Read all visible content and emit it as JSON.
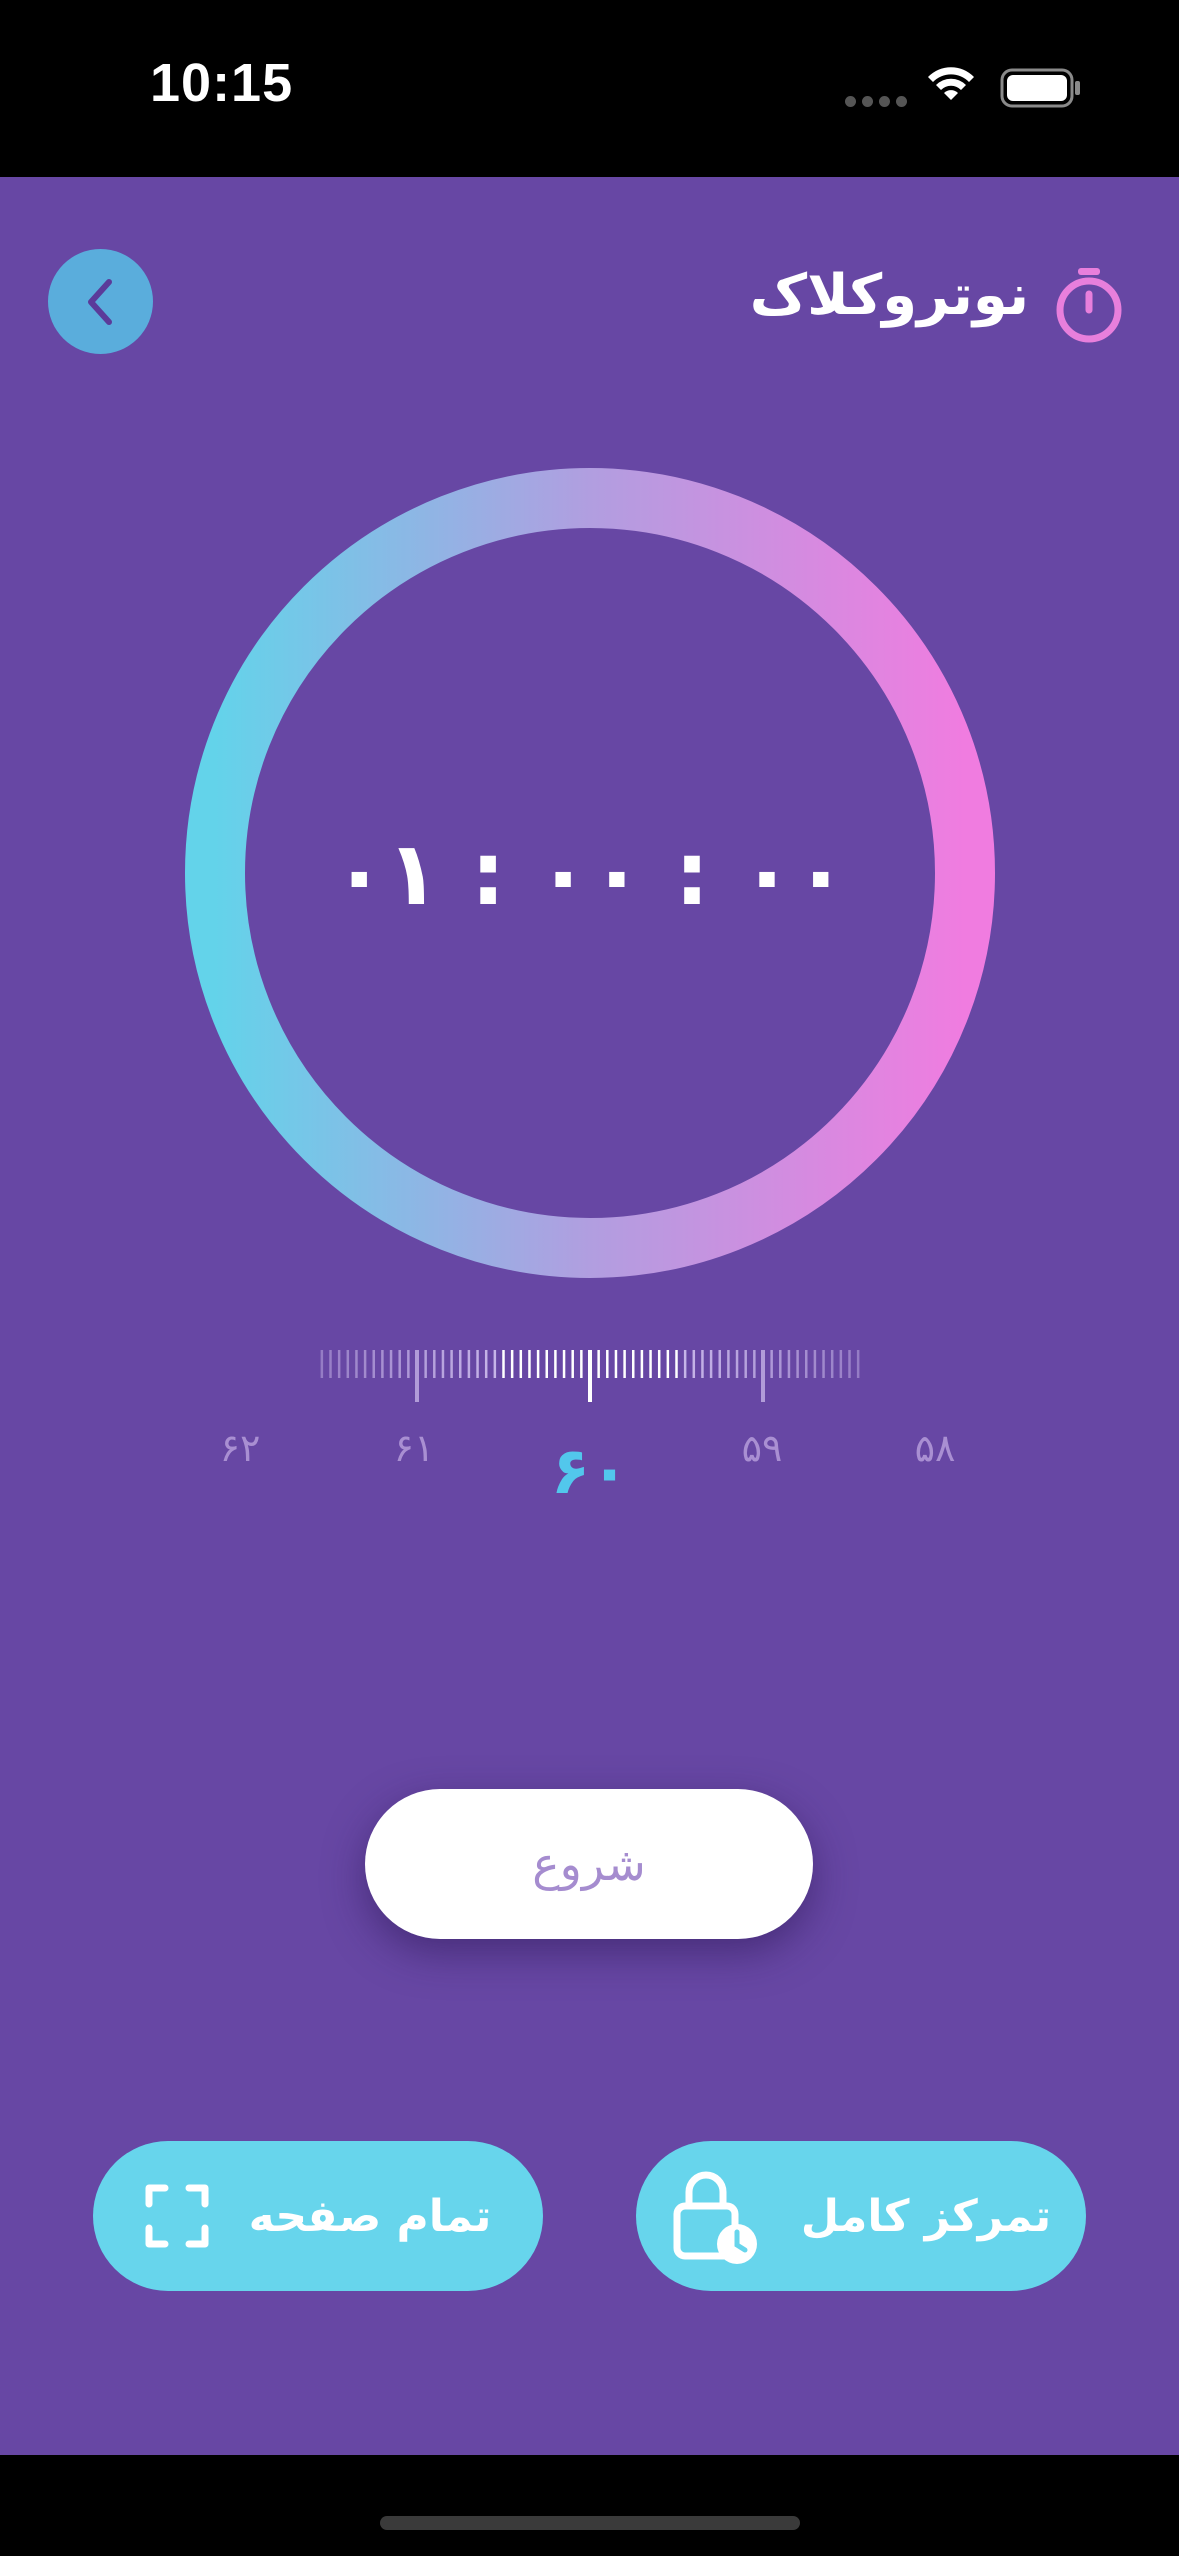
{
  "status_bar": {
    "time": "10:15"
  },
  "header": {
    "title": "نوتروکلاک",
    "back_icon": "chevron-left-icon",
    "timer_icon": "stopwatch-icon"
  },
  "timer": {
    "display": "۰۱ : ۰۰ : ۰۰",
    "gradient_colors": [
      "#63d3ea",
      "#b19ee0",
      "#f07ce0"
    ]
  },
  "ruler": {
    "selected_value": "۶۰",
    "labels": [
      "۶۲",
      "۶۱",
      "۵۹",
      "۵۸"
    ]
  },
  "actions": {
    "start_label": "شروع",
    "fullscreen_label": "تمام صفحه",
    "focus_label": "تمرکز کامل"
  },
  "colors": {
    "background": "#6747a4",
    "accent": "#67d5ec",
    "back_button": "#5aaddc",
    "selected_value": "#52c7ec",
    "timer_icon": "#e87fdc"
  }
}
